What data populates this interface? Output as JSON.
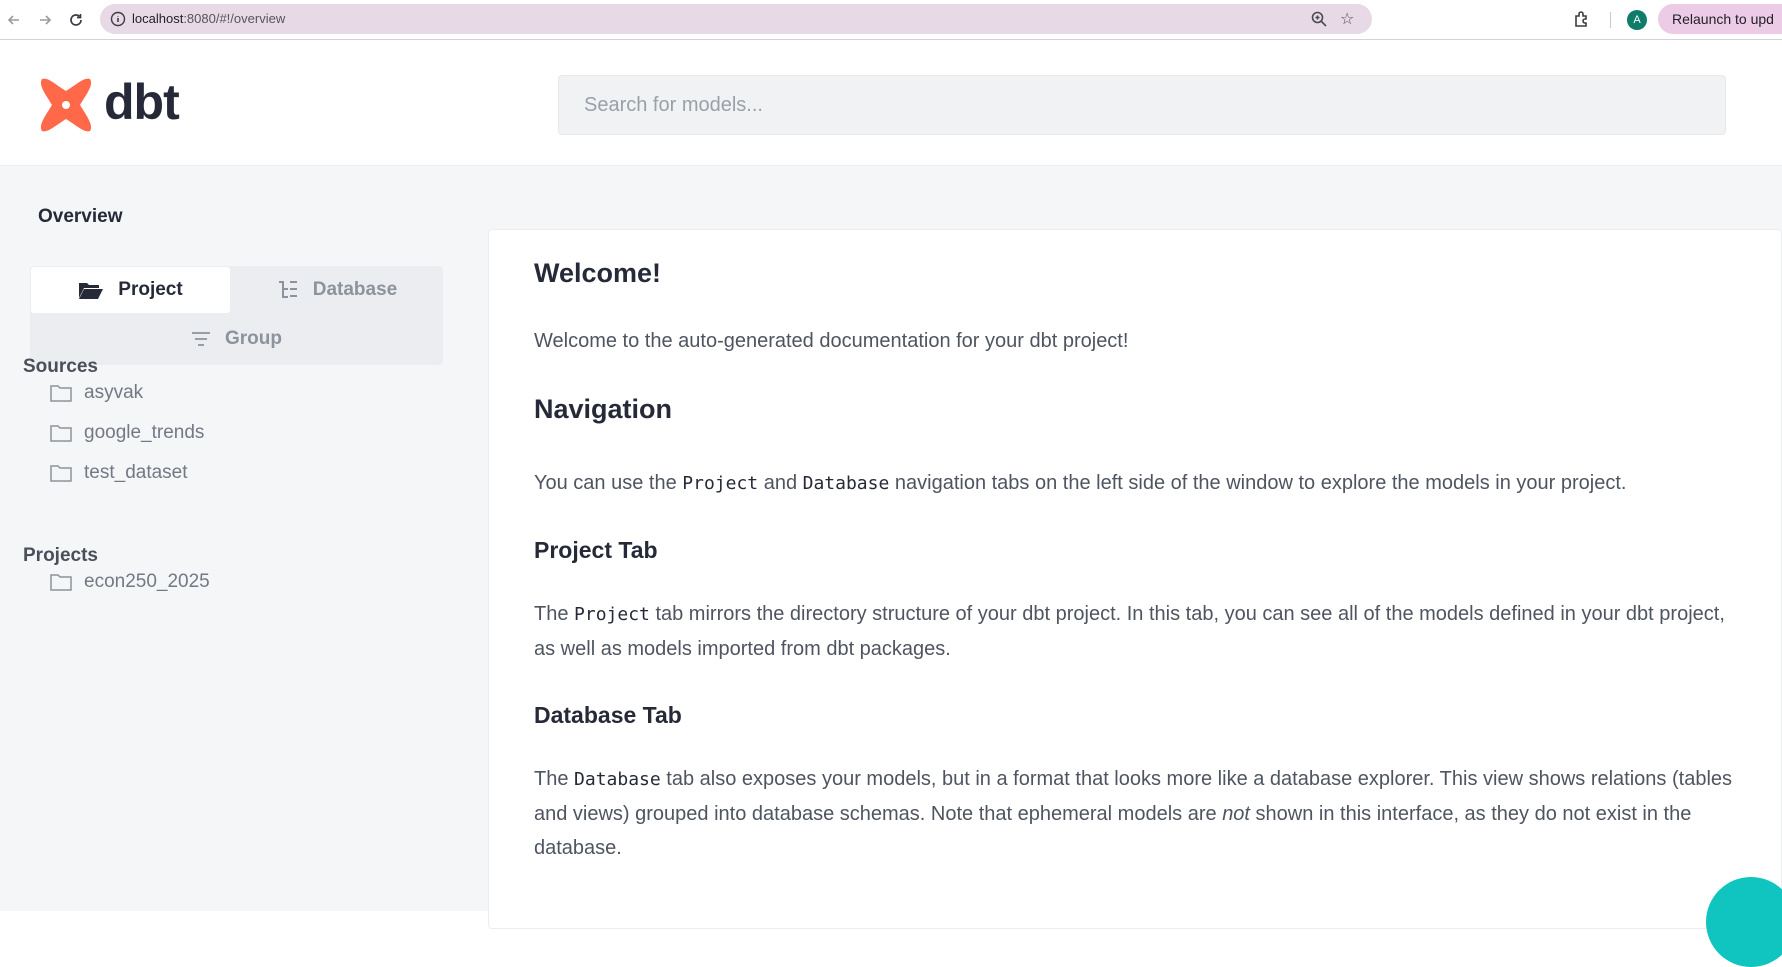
{
  "browser": {
    "url_host": "localhost",
    "url_rest": ":8080/#!/overview",
    "relaunch_label": "Relaunch to upd",
    "avatar_letter": "A"
  },
  "header": {
    "logo_text": "dbt",
    "search_placeholder": "Search for models..."
  },
  "sidebar": {
    "title": "Overview",
    "tabs": {
      "project": "Project",
      "database": "Database",
      "group": "Group"
    },
    "sources_title": "Sources",
    "sources": [
      "asyvak",
      "google_trends",
      "test_dataset"
    ],
    "projects_title": "Projects",
    "projects": [
      "econ250_2025"
    ]
  },
  "content": {
    "welcome_title": "Welcome!",
    "welcome_text": "Welcome to the auto-generated documentation for your dbt project!",
    "nav_title": "Navigation",
    "nav_pre": "You can use the ",
    "nav_code1": "Project",
    "nav_mid": " and ",
    "nav_code2": "Database",
    "nav_post": " navigation tabs on the left side of the window to explore the models in your project.",
    "project_tab_title": "Project Tab",
    "project_pre": "The ",
    "project_code": "Project",
    "project_post": " tab mirrors the directory structure of your dbt project. In this tab, you can see all of the models defined in your dbt project, as well as models imported from dbt packages.",
    "database_tab_title": "Database Tab",
    "database_pre": "The ",
    "database_code": "Database",
    "database_mid": " tab also exposes your models, but in a format that looks more like a database explorer. This view shows relations (tables and views) grouped into database schemas. Note that ephemeral models are ",
    "database_em": "not",
    "database_post": " shown in this interface, as they do not exist in the database."
  },
  "colors": {
    "brand": "#ff694a",
    "text": "#262a38",
    "fab": "#10c5c0"
  }
}
